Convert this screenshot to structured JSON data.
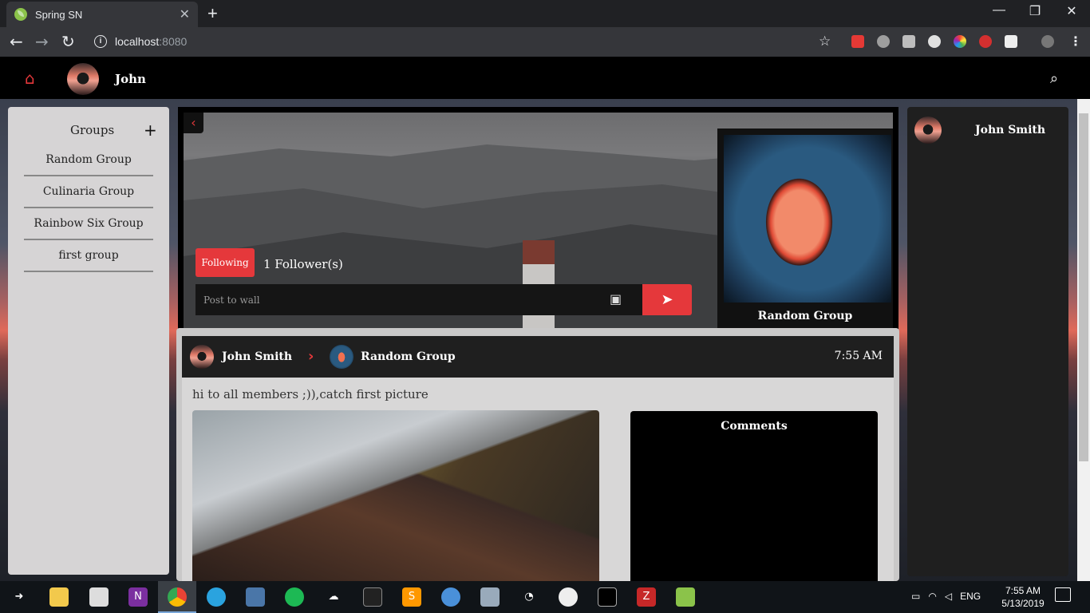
{
  "browser": {
    "tab_title": "Spring SN",
    "tab_close": "✕",
    "new_tab": "+",
    "url_host": "localhost",
    "url_port": ":8080",
    "window_controls": [
      "—",
      "❐",
      "✕"
    ]
  },
  "app": {
    "header": {
      "username": "John"
    },
    "groups_panel": {
      "title": "Groups",
      "add_label": "+",
      "items": [
        "Random Group",
        "Culinaria Group",
        "Rainbow Six Group",
        "first group"
      ]
    },
    "group_page": {
      "follow_button": "Following",
      "followers": "1 Follower(s)",
      "post_placeholder": "Post to wall",
      "group_name": "Random Group"
    },
    "post": {
      "author": "John Smith",
      "group": "Random Group",
      "time": "7:55 AM",
      "text": "hi to all members ;)),catch first picture",
      "comments_title": "Comments"
    },
    "right_panel": {
      "user": "John Smith"
    }
  },
  "taskbar": {
    "language": "ENG",
    "time": "7:55 AM",
    "date": "5/13/2019"
  },
  "colors": {
    "accent": "#e5383b",
    "header": "#000000",
    "panel": "#1f1f1f"
  },
  "icons": [
    "home-icon",
    "search-icon",
    "back-arrow-icon",
    "image-icon",
    "send-icon",
    "plus-icon"
  ]
}
